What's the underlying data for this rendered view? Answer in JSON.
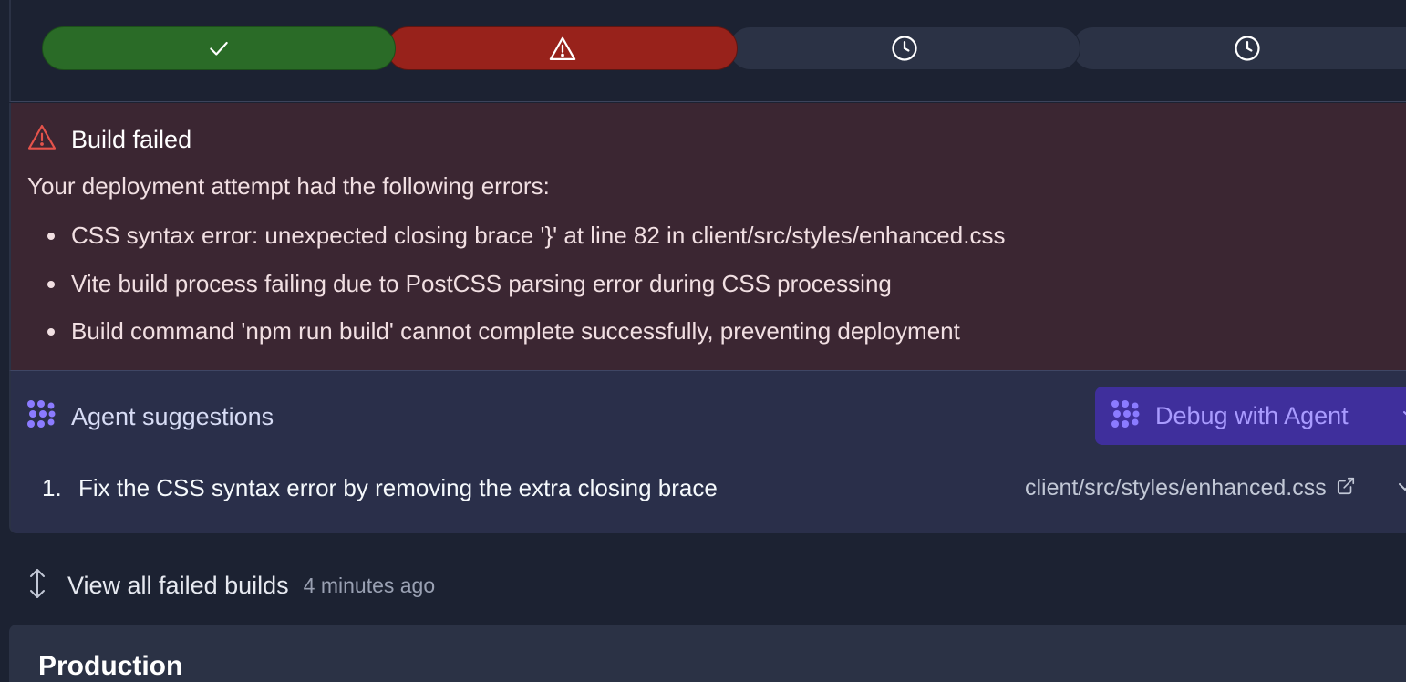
{
  "stepper": {
    "steps": [
      {
        "status": "success",
        "icon": "check-icon",
        "color": "#2a6b27"
      },
      {
        "status": "error",
        "icon": "warning-icon",
        "color": "#98221b"
      },
      {
        "status": "pending",
        "icon": "clock-icon",
        "color": "#2b3245"
      },
      {
        "status": "pending",
        "icon": "clock-icon",
        "color": "#2b3245"
      }
    ]
  },
  "error": {
    "title": "Build failed",
    "intro": "Your deployment attempt had the following errors:",
    "items": [
      "CSS syntax error: unexpected closing brace '}' at line 82 in client/src/styles/enhanced.css",
      "Vite build process failing due to PostCSS parsing error during CSS processing",
      "Build command 'npm run build' cannot complete successfully, preventing deployment"
    ],
    "accent": "#e5534b"
  },
  "agent": {
    "title": "Agent suggestions",
    "debug_button": "Debug with Agent",
    "accent": "#8b7bff",
    "suggestions": [
      {
        "number": "1.",
        "text": "Fix the CSS syntax error by removing the extra closing brace",
        "file": "client/src/styles/enhanced.css"
      }
    ]
  },
  "failed_builds": {
    "label": "View all failed builds",
    "time": "4 minutes ago"
  },
  "production": {
    "title": "Production"
  }
}
